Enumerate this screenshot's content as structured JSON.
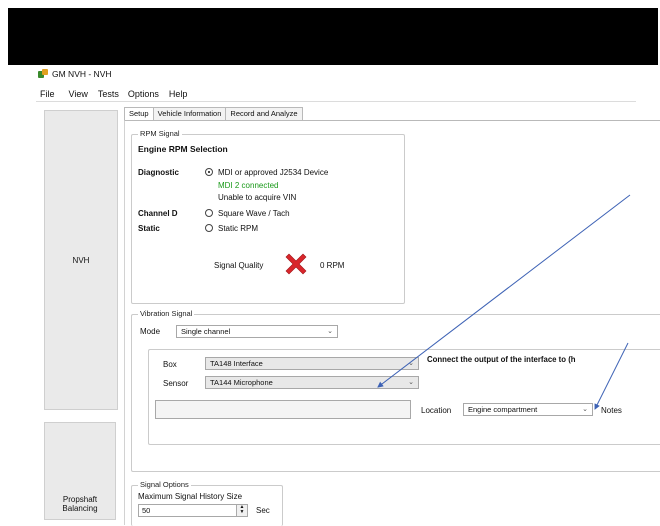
{
  "window": {
    "title": "GM NVH - NVH"
  },
  "menu": [
    "File",
    "View",
    "Tests",
    "Options",
    "Help"
  ],
  "sidebar": {
    "nvh_label": "NVH",
    "propshaft_label": "Propshaft Balancing"
  },
  "tabs": [
    {
      "label": "Setup",
      "active": true
    },
    {
      "label": "Vehicle Information",
      "active": false
    },
    {
      "label": "Record and Analyze",
      "active": false
    }
  ],
  "rpm_signal": {
    "group_title": "RPM Signal",
    "heading": "Engine RPM Selection",
    "diagnostic_label": "Diagnostic",
    "diagnostic_option": "MDI or approved J2534 Device",
    "mdi_status": "MDI 2 connected",
    "vin_status": "Unable to acquire VIN",
    "channel_label": "Channel D",
    "channel_option": "Square Wave / Tach",
    "static_label": "Static",
    "static_option": "Static RPM",
    "signal_quality_label": "Signal Quality",
    "rpm_value": "0 RPM",
    "selected": "diagnostic"
  },
  "vibration": {
    "group_title": "Vibration Signal",
    "mode_label": "Mode",
    "mode_value": "Single channel",
    "box_label": "Box",
    "box_value": "TA148 Interface",
    "sensor_label": "Sensor",
    "sensor_value": "TA144 Microphone",
    "instruction": "Connect the output of the interface to (h",
    "location_label": "Location",
    "location_value": "Engine compartment",
    "notes_label": "Notes"
  },
  "signal_options": {
    "group_title": "Signal Options",
    "history_label": "Maximum Signal History Size",
    "history_value": "50",
    "unit": "Sec"
  },
  "colors": {
    "annotation_arrow": "#3d62b5",
    "error_x": "#d9262b",
    "status_green": "#1a9a1a"
  }
}
